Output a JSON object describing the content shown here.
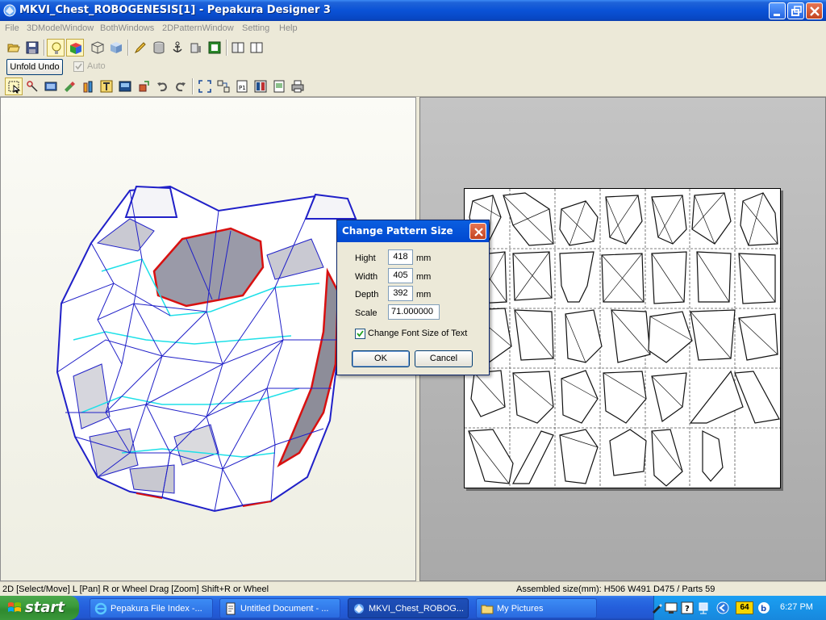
{
  "window": {
    "title": "MKVI_Chest_ROBOGENESIS[1] - Pepakura Designer 3"
  },
  "menu": [
    "File",
    "3DModelWindow",
    "BothWindows",
    "2DPatternWindow",
    "Setting",
    "Help"
  ],
  "toolbar": {
    "unfold_undo_label": "Unfold Undo",
    "auto_label": "Auto"
  },
  "dialog": {
    "title": "Change Pattern Size",
    "fields": [
      {
        "label": "Hight",
        "value": "418",
        "unit": "mm"
      },
      {
        "label": "Width",
        "value": "405",
        "unit": "mm"
      },
      {
        "label": "Depth",
        "value": "392",
        "unit": "mm"
      },
      {
        "label": "Scale",
        "value": "71.000000"
      }
    ],
    "checkbox_label": "Change Font Size of Text",
    "checkbox_checked": true,
    "ok_label": "OK",
    "cancel_label": "Cancel"
  },
  "status": {
    "left": "2D [Select/Move] L [Pan] R or Wheel Drag [Zoom] Shift+R or Wheel",
    "right": "Assembled size(mm): H506 W491 D475 / Parts 59"
  },
  "taskbar": {
    "start_label": "start",
    "tasks": [
      {
        "label": "Pepakura File Index -...",
        "active": false
      },
      {
        "label": "Untitled Document - ...",
        "active": false
      },
      {
        "label": "MKVI_Chest_ROBOG...",
        "active": true
      },
      {
        "label": "My Pictures",
        "active": false
      }
    ],
    "tray_badge": "64",
    "clock": "6:27 PM"
  },
  "colors": {
    "title_blue": "#0a52d6",
    "mesh_blue": "#2020c8",
    "mesh_cyan": "#1ee0e8",
    "seam_red": "#d81010",
    "taskbar_blue": "#245edb",
    "start_green": "#3c9b3c"
  }
}
